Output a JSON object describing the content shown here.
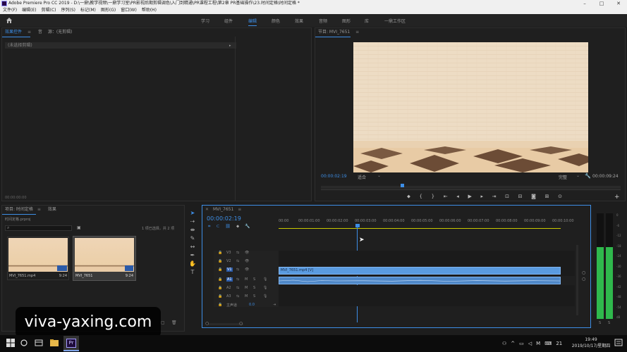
{
  "titlebar": {
    "title": "Adobe Premiere Pro CC 2019 - D:\\一鼎\\教学视频\\一鼎学习室\\PR影视后期剪辑调色\\入门到精通\\PR课程工程\\第2章 PR基础操作\\23.时间定格\\时间定格 *",
    "minimize": "–",
    "maximize": "□",
    "close": "✕"
  },
  "menu": [
    "文件(F)",
    "编辑(E)",
    "剪辑(C)",
    "序列(S)",
    "标记(M)",
    "图形(G)",
    "窗口(W)",
    "帮助(H)"
  ],
  "workspaces": [
    {
      "label": "学习",
      "active": false
    },
    {
      "label": "组件",
      "active": false
    },
    {
      "label": "编辑",
      "active": true
    },
    {
      "label": "颜色",
      "active": false
    },
    {
      "label": "效果",
      "active": false
    },
    {
      "label": "音频",
      "active": false
    },
    {
      "label": "图形",
      "active": false
    },
    {
      "label": "库",
      "active": false
    },
    {
      "label": "一鼎工作区",
      "active": false
    }
  ],
  "effect_controls": {
    "tab1": "效果控件",
    "tab2": "源：(无剪辑)",
    "tab3": "音",
    "row": "(未选择剪辑)",
    "footer_time": "00:00:00:00"
  },
  "program_monitor": {
    "tab": "节目: MVI_7651",
    "timecode_left": "00:00:02:19",
    "fit": "适合",
    "quality": "完整",
    "timecode_right": "00:00:09:24"
  },
  "project": {
    "tab1": "项目: 时间定格",
    "tab2": "效果",
    "filename": "时间定格.prproj",
    "search_placeholder": "",
    "selection_info": "1 项已选择，共 2 项",
    "clips": [
      {
        "name": "MVI_7651.mp4",
        "duration": "9:24"
      },
      {
        "name": "MVI_7651",
        "duration": "9:24"
      }
    ]
  },
  "timeline": {
    "tab": "MVI_7651",
    "timecode": "00:00:02:19",
    "ruler": [
      "00:00",
      "00:00:01:00",
      "00:00:02:00",
      "00:00:03:00",
      "00:00:04:00",
      "00:00:05:00",
      "00:00:06:00",
      "00:00:07:00",
      "00:00:08:00",
      "00:00:09:00",
      "00:00:10:00"
    ],
    "video_tracks": [
      "V3",
      "V2",
      "V1"
    ],
    "audio_tracks": [
      "A1",
      "A2",
      "A3"
    ],
    "master_label": "主声道",
    "master_value": "0.0",
    "video_clip": "MVI_7651.mp4 [V]"
  },
  "meter": {
    "labels": [
      "0",
      "-6",
      "-12",
      "-18",
      "-24",
      "-30",
      "-36",
      "-42",
      "-48",
      "-54",
      "dB"
    ],
    "solo": [
      "S",
      "S"
    ],
    "level_left": 0.68,
    "level_right": 0.68
  },
  "taskbar": {
    "time": "19:49",
    "date": "2019/10/17/星期四",
    "lang": "M",
    "tray_num": "21"
  },
  "watermark": "viva-yaxing.com"
}
